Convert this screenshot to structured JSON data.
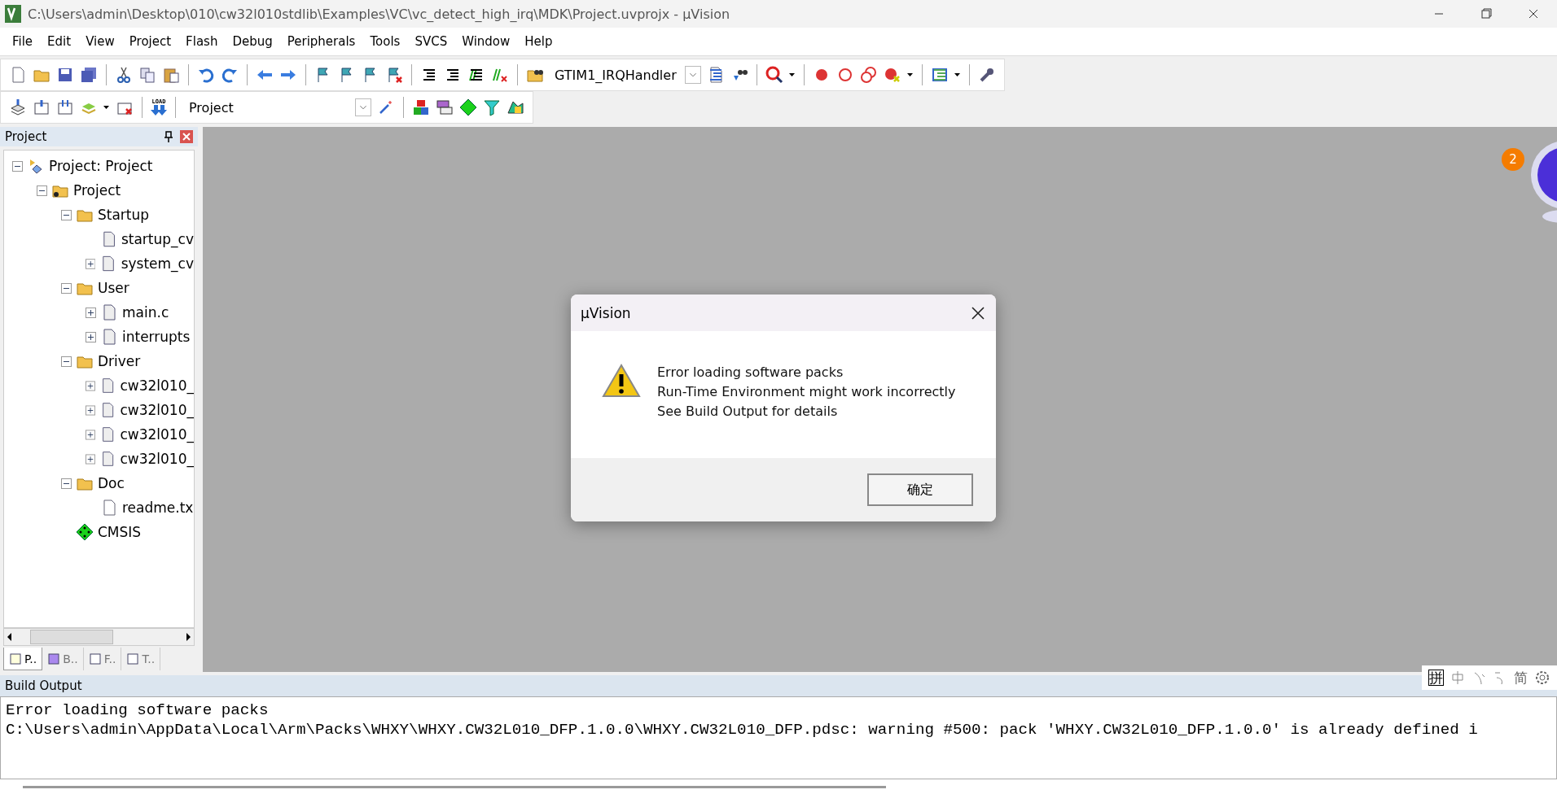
{
  "window": {
    "title": "C:\\Users\\admin\\Desktop\\010\\cw32l010stdlib\\Examples\\VC\\vc_detect_high_irq\\MDK\\Project.uvprojx - µVision"
  },
  "menu": [
    "File",
    "Edit",
    "View",
    "Project",
    "Flash",
    "Debug",
    "Peripherals",
    "Tools",
    "SVCS",
    "Window",
    "Help"
  ],
  "toolbar": {
    "function_combo": "GTIM1_IRQHandler",
    "target_combo": "Project",
    "load_label": "LOAD"
  },
  "project_panel": {
    "title": "Project",
    "tree": [
      {
        "label": "Project: Project",
        "kind": "root",
        "expanded": true,
        "children": [
          {
            "label": "Project",
            "kind": "group",
            "expanded": true,
            "children": [
              {
                "label": "Startup",
                "kind": "folder",
                "expanded": true,
                "children": [
                  {
                    "label": "startup_cv",
                    "kind": "file"
                  },
                  {
                    "label": "system_cv",
                    "kind": "file",
                    "expanded": false
                  }
                ]
              },
              {
                "label": "User",
                "kind": "folder",
                "expanded": true,
                "children": [
                  {
                    "label": "main.c",
                    "kind": "file",
                    "expanded": false
                  },
                  {
                    "label": "interrupts",
                    "kind": "file",
                    "expanded": false
                  }
                ]
              },
              {
                "label": "Driver",
                "kind": "folder",
                "expanded": true,
                "children": [
                  {
                    "label": "cw32l010_",
                    "kind": "file",
                    "expanded": false
                  },
                  {
                    "label": "cw32l010_",
                    "kind": "file",
                    "expanded": false
                  },
                  {
                    "label": "cw32l010_",
                    "kind": "file",
                    "expanded": false
                  },
                  {
                    "label": "cw32l010_",
                    "kind": "file",
                    "expanded": false
                  }
                ]
              },
              {
                "label": "Doc",
                "kind": "folder",
                "expanded": true,
                "children": [
                  {
                    "label": "readme.tx",
                    "kind": "doc"
                  }
                ]
              },
              {
                "label": "CMSIS",
                "kind": "component"
              }
            ]
          }
        ]
      }
    ],
    "tabs": [
      {
        "label": "P..",
        "selected": true
      },
      {
        "label": "B..",
        "selected": false
      },
      {
        "label": "F..",
        "selected": false
      },
      {
        "label": "T..",
        "selected": false
      }
    ]
  },
  "assistant_badge": "2",
  "dialog": {
    "title": "µVision",
    "lines": [
      "Error loading software packs",
      "Run-Time Environment might work incorrectly",
      "See Build Output for details"
    ],
    "button": "确定"
  },
  "ime_bar": [
    "拼",
    "简"
  ],
  "build_output": {
    "title": "Build Output",
    "lines": [
      "Error loading software packs",
      "C:\\Users\\admin\\AppData\\Local\\Arm\\Packs\\WHXY\\WHXY.CW32L010_DFP.1.0.0\\WHXY.CW32L010_DFP.pdsc: warning #500: pack 'WHXY.CW32L010_DFP.1.0.0' is already defined i"
    ]
  }
}
